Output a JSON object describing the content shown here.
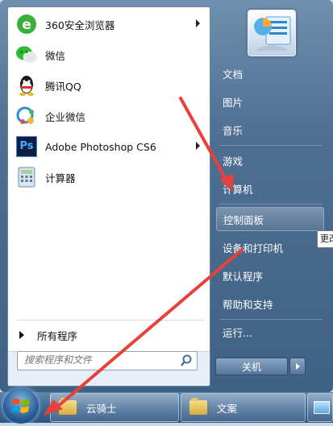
{
  "left_items": [
    {
      "label": "360安全浏览器",
      "icon": "360-browser-icon",
      "has_submenu": true
    },
    {
      "label": "微信",
      "icon": "wechat-icon",
      "has_submenu": false
    },
    {
      "label": "腾讯QQ",
      "icon": "qq-icon",
      "has_submenu": false
    },
    {
      "label": "企业微信",
      "icon": "wecom-icon",
      "has_submenu": false
    },
    {
      "label": "Adobe Photoshop CS6",
      "icon": "photoshop-icon",
      "icon_text": "Ps",
      "has_submenu": true
    },
    {
      "label": "计算器",
      "icon": "calculator-icon",
      "has_submenu": false
    }
  ],
  "all_programs": "所有程序",
  "search": {
    "placeholder": "搜索程序和文件"
  },
  "right_items": [
    {
      "label": "文档"
    },
    {
      "label": "图片"
    },
    {
      "label": "音乐"
    },
    {
      "label": "游戏"
    },
    {
      "label": "计算机"
    },
    {
      "label": "控制面板",
      "highlighted": true
    },
    {
      "label": "设备和打印机"
    },
    {
      "label": "默认程序"
    },
    {
      "label": "帮助和支持"
    },
    {
      "label": "运行..."
    }
  ],
  "shutdown": {
    "label": "关机"
  },
  "tooltip": "更改",
  "taskbar": {
    "buttons": [
      {
        "label": "云骑士"
      },
      {
        "label": "文案"
      }
    ]
  },
  "annotation_color": "#e8413a"
}
